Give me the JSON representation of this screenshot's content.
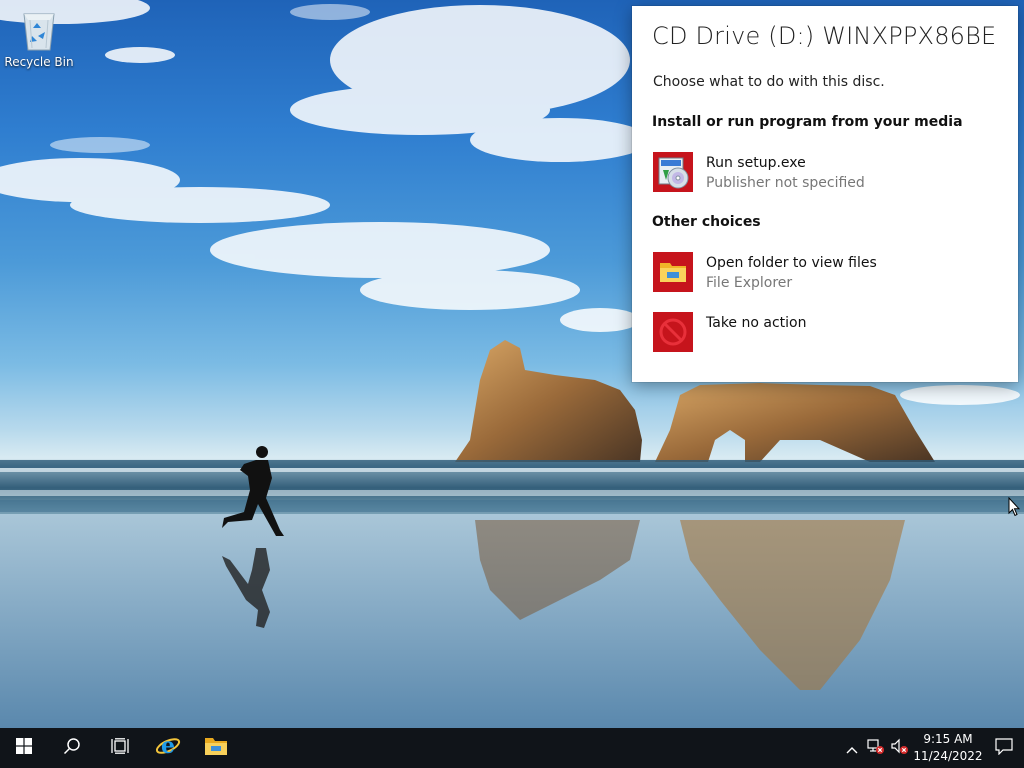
{
  "desktop": {
    "icons": [
      {
        "label": "Recycle Bin",
        "icon": "recycle-bin-icon"
      }
    ]
  },
  "autoplay": {
    "title": "CD Drive (D:) WINXPPX86BE",
    "subtitle": "Choose what to do with this disc.",
    "sections": [
      {
        "heading": "Install or run program from your media",
        "choices": [
          {
            "label": "Run setup.exe",
            "sublabel": "Publisher not specified",
            "icon": "setup-disc-icon"
          }
        ]
      },
      {
        "heading": "Other choices",
        "choices": [
          {
            "label": "Open folder to view files",
            "sublabel": "File Explorer",
            "icon": "folder-icon"
          },
          {
            "label": "Take no action",
            "sublabel": "",
            "icon": "no-action-icon"
          }
        ]
      }
    ],
    "colors": {
      "icon_tile": "#c6141c",
      "background": "#ffffff"
    }
  },
  "taskbar": {
    "buttons": [
      {
        "name": "start",
        "icon": "windows-logo-icon"
      },
      {
        "name": "search",
        "icon": "search-icon"
      },
      {
        "name": "task-view",
        "icon": "task-view-icon"
      },
      {
        "name": "internet-explorer",
        "icon": "internet-explorer-icon"
      },
      {
        "name": "file-explorer",
        "icon": "file-explorer-icon"
      }
    ],
    "tray": {
      "icons": [
        "chevron-up-icon",
        "network-error-icon",
        "volume-muted-icon"
      ],
      "time": "9:15 AM",
      "date": "11/24/2022",
      "notification_icon": "action-center-icon"
    },
    "colors": {
      "background": "#101419"
    }
  }
}
